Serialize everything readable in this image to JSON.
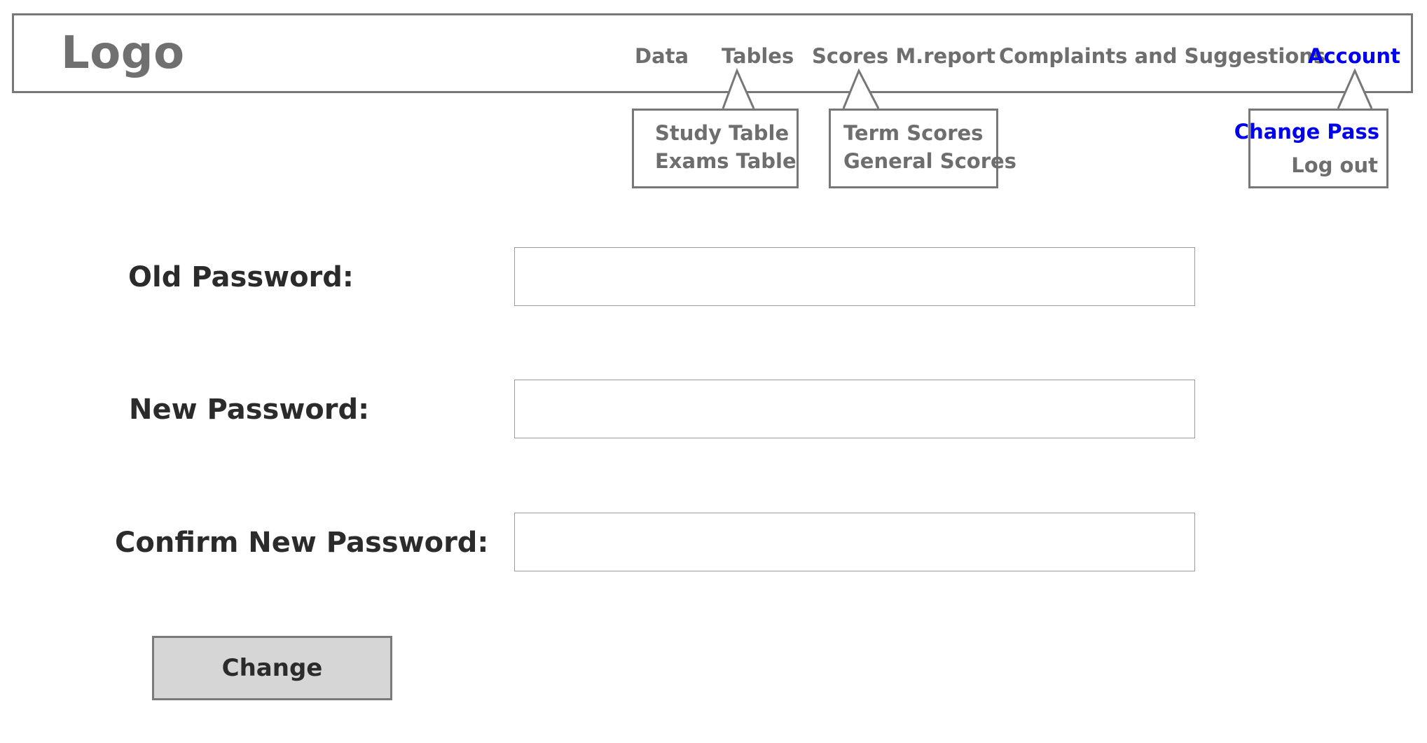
{
  "header": {
    "logo": "Logo",
    "nav": {
      "data": "Data",
      "tables": "Tables",
      "scores": "Scores M.report",
      "complaints": "Complaints and Suggestions",
      "account": "Account"
    }
  },
  "dropdowns": {
    "tables": [
      "Study Table",
      "Exams Table"
    ],
    "scores": [
      "Term Scores",
      "General Scores"
    ],
    "account": [
      "Change Pass",
      "Log out"
    ]
  },
  "form": {
    "old_password_label": "Old Password:",
    "old_password_value": "",
    "new_password_label": "New Password:",
    "new_password_value": "",
    "confirm_password_label": "Confirm New Password:",
    "confirm_password_value": "",
    "submit_label": "Change"
  },
  "colors": {
    "active": "#0000ee",
    "nav_text": "#6e6e6e",
    "border": "#777777",
    "button_bg": "#d6d6d6"
  }
}
